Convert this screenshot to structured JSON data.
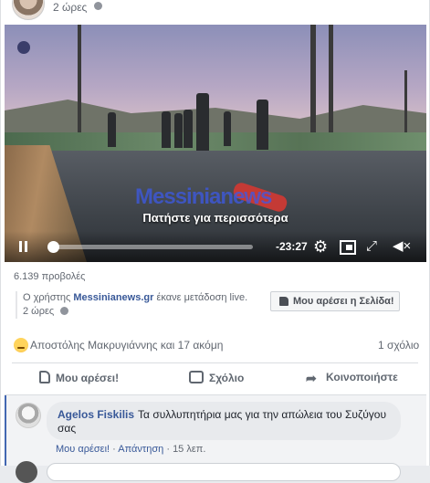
{
  "post": {
    "time": "2 ώρες"
  },
  "video": {
    "watermark": "Messinianews",
    "overlay_caption": "Πατήστε για περισσότερα",
    "progress": 0.02,
    "remaining_time": "-23:27"
  },
  "stats": {
    "views": "6.139 προβολές"
  },
  "broadcast": {
    "prefix": "Ο χρήστης ",
    "site": "Messinianews.gr",
    "suffix": " έκανε μετάδοση live.",
    "time": "2 ώρες",
    "like_page_label": "Μου αρέσει η Σελίδα!"
  },
  "reactions": {
    "names": "Αποστόλης Μακρυγιάννης και 17 ακόμη",
    "comment_count": "1 σχόλιο"
  },
  "actions": {
    "like": "Μου αρέσει!",
    "comment": "Σχόλιο",
    "share": "Κοινοποιήστε"
  },
  "comment": {
    "author": "Agelos Fiskilis",
    "text": "Τα συλλυπητήρια μας για την απώλεια του Συζύγου σας",
    "like_label": "Μου αρέσει!",
    "reply_label": "Απάντηση",
    "time": "15 λεπ."
  },
  "colors": {
    "link": "#385898",
    "accent": "#4267b2"
  }
}
